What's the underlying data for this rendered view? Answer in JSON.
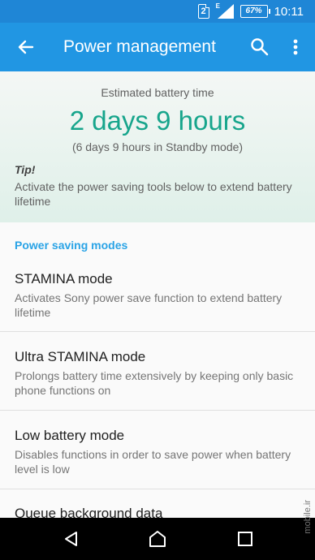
{
  "status_bar": {
    "sim_slot": "2",
    "network_type": "E",
    "battery_percent": "67%",
    "time": "10:11"
  },
  "app_bar": {
    "title": "Power management",
    "back_icon": "arrow-left-icon",
    "search_icon": "search-icon",
    "more_icon": "more-vert-icon"
  },
  "summary": {
    "label": "Estimated battery time",
    "value": "2 days 9 hours",
    "standby": "(6 days 9 hours in Standby mode)",
    "tip_title": "Tip!",
    "tip_text": "Activate the power saving tools below to extend battery lifetime"
  },
  "section_title": "Power saving modes",
  "items": [
    {
      "title": "STAMINA mode",
      "subtitle": "Activates Sony power save function to extend battery lifetime"
    },
    {
      "title": "Ultra STAMINA mode",
      "subtitle": "Prolongs battery time extensively by keeping only basic phone functions on"
    },
    {
      "title": "Low battery mode",
      "subtitle": "Disables functions in order to save power when battery level is low"
    },
    {
      "title": "Queue background data",
      "subtitle": ""
    }
  ],
  "navigation": {
    "back": "back-triangle-icon",
    "home": "home-circle-icon",
    "recents": "recents-square-icon"
  },
  "watermark": "mobile.ir",
  "colors": {
    "status_bar": "#1f86d6",
    "app_bar": "#2196e3",
    "accent_value": "#17a58c",
    "section_title": "#29a3e6"
  }
}
